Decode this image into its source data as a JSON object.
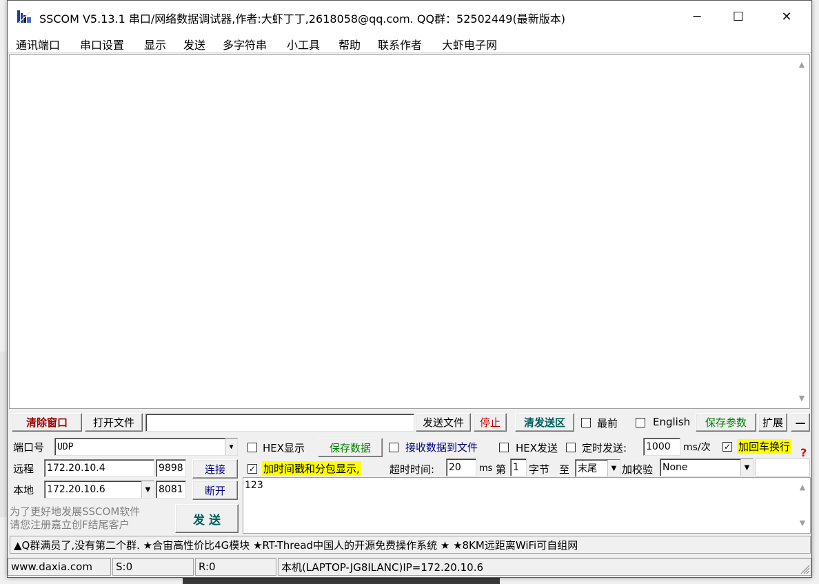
{
  "window": {
    "title": "SSCOM V5.13.1 串口/网络数据调试器,作者:大虾丁丁,2618058@qq.com. QQ群：52502449(最新版本)",
    "minimize_glyph": "─",
    "maximize_glyph": "☐",
    "close_glyph": "✕"
  },
  "menu": [
    "通讯端口",
    "串口设置",
    "显示",
    "发送",
    "多字符串",
    "小工具",
    "帮助",
    "联系作者",
    "大虾电子网"
  ],
  "toolbar": {
    "clear_window": "清除窗口",
    "open_file": "打开文件",
    "file_path": "",
    "send_file": "发送文件",
    "stop": "停止",
    "clear_send_area": "清发送区",
    "topmost_label": "最前",
    "english_label": "English",
    "save_params": "保存参数",
    "expand": "扩展",
    "collapse": "—"
  },
  "connection": {
    "port_label": "端口号",
    "port_value": "UDP",
    "remote_label": "远程",
    "remote_ip": "172.20.10.4",
    "remote_port": "9898",
    "connect_button": "连接",
    "local_label": "本地",
    "local_ip": "172.20.10.6",
    "local_port": "8081",
    "disconnect_button": "断开",
    "promo_line1": "为了更好地发展SSCOM软件",
    "promo_line2": "请您注册嘉立创F结尾客户",
    "send_button": "发 送"
  },
  "options": {
    "hex_display": "HEX显示",
    "save_data": "保存数据",
    "recv_to_file": "接收数据到文件",
    "hex_send": "HEX发送",
    "timed_send": "定时发送:",
    "interval_value": "1000",
    "interval_unit": "ms/次",
    "add_crlf": "加回车换行",
    "add_crlf_checked": true,
    "timestamp_label": "加时间戳和分包显示,",
    "timestamp_checked": true,
    "timeout_label": "超时时间:",
    "timeout_value": "20",
    "timeout_unit": "ms",
    "byte_prefix": "第",
    "byte_index": "1",
    "byte_suffix": "字节",
    "to_label": "至",
    "to_value": "末尾",
    "checksum_label": "加校验",
    "checksum_value": "None",
    "help_mark": "?"
  },
  "send_text": "123",
  "ticker": "▲Q群满员了,没有第二个群. ★合宙高性价比4G模块 ★RT-Thread中国人的开源免费操作系统 ★ ★8KM远距离WiFi可自组网",
  "status": {
    "website": "www.daxia.com",
    "sent": "S:0",
    "received": "R:0",
    "host_info": "本机(LAPTOP-JG8ILANC)IP=172.20.10.6"
  },
  "colors": {
    "clear_window_text": "#9b0000",
    "stop_text": "#c00000",
    "clear_send_text": "#006060",
    "save_params_text": "#008000",
    "link_text": "#000080",
    "highlight_bg": "#ffff00",
    "help_mark": "#e00000"
  }
}
